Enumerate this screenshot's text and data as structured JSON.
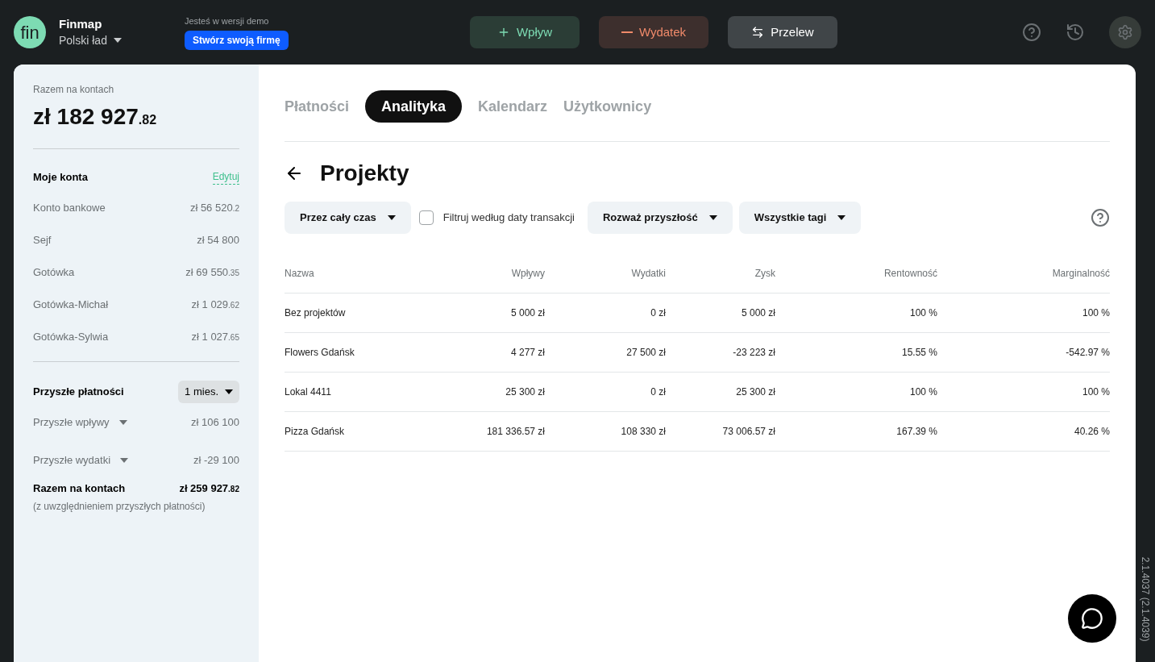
{
  "header": {
    "brand": "Finmap",
    "logo": "fin",
    "company": "Polski ład",
    "demo_note": "Jesteś w wersji demo",
    "demo_button": "Stwórz swoją firmę",
    "actions": [
      {
        "kind": "income",
        "label": "Wpływ"
      },
      {
        "kind": "expense",
        "label": "Wydatek"
      },
      {
        "kind": "transfer",
        "label": "Przelew"
      }
    ]
  },
  "sidebar": {
    "total_label": "Razem na kontach",
    "total": "zł 182 927",
    "total_cents": ".82",
    "accounts_title": "Moje konta",
    "edit_link": "Edytuj",
    "accounts": [
      {
        "name": "Konto bankowe",
        "amount": "zł 56 520",
        "cents": ".2"
      },
      {
        "name": "Sejf",
        "amount": "zł 54 800"
      },
      {
        "name": "Gotówka",
        "amount": "zł 69 550",
        "cents": ".35"
      },
      {
        "name": "Gotówka-Michał",
        "amount": "zł 1 029",
        "cents": ".62"
      },
      {
        "name": "Gotówka-Sylwia",
        "amount": "zł 1 027",
        "cents": ".65"
      }
    ],
    "future_title": "Przyszłe płatności",
    "period": "1 mies.",
    "future": [
      {
        "name": "Przyszłe wpływy",
        "amount": "zł 106 100"
      },
      {
        "name": "Przyszłe wydatki",
        "amount": "zł -29 100"
      }
    ],
    "grand_label": "Razem na kontach",
    "grand_total": "zł 259 927",
    "grand_cents": ".82",
    "grand_note": "(z uwzględnieniem przyszłych płatności)"
  },
  "tabs": [
    {
      "label": "Płatności",
      "selected": false
    },
    {
      "label": "Analityka",
      "selected": true
    },
    {
      "label": "Kalendarz",
      "selected": false
    },
    {
      "label": "Użytkownicy",
      "selected": false
    }
  ],
  "page_title": "Projekty",
  "filters": {
    "period": "Przez cały czas",
    "date_filter": {
      "label": "Filtruj według daty transakcji",
      "checked": false
    },
    "future": "Rozważ przyszłość",
    "tags": "Wszystkie tagi"
  },
  "table": {
    "columns": [
      "Nazwa",
      "Wpływy",
      "Wydatki",
      "Zysk",
      "Rentowność",
      "Marginalność"
    ],
    "rows": [
      [
        "Bez projektów",
        "5 000 zł",
        "0 zł",
        "5 000 zł",
        "100 %",
        "100 %"
      ],
      [
        "Flowers Gdańsk",
        "4 277 zł",
        "27 500 zł",
        "-23 223 zł",
        "15.55 %",
        "-542.97 %"
      ],
      [
        "Lokal 4411",
        "25 300 zł",
        "0 zł",
        "25 300 zł",
        "100 %",
        "100 %"
      ],
      [
        "Pizza Gdańsk",
        "181 336.57 zł",
        "108 330 zł",
        "73 006.57 zł",
        "167.39 %",
        "40.26 %"
      ]
    ]
  },
  "version": "2.1.4037 (2.1.4039)"
}
